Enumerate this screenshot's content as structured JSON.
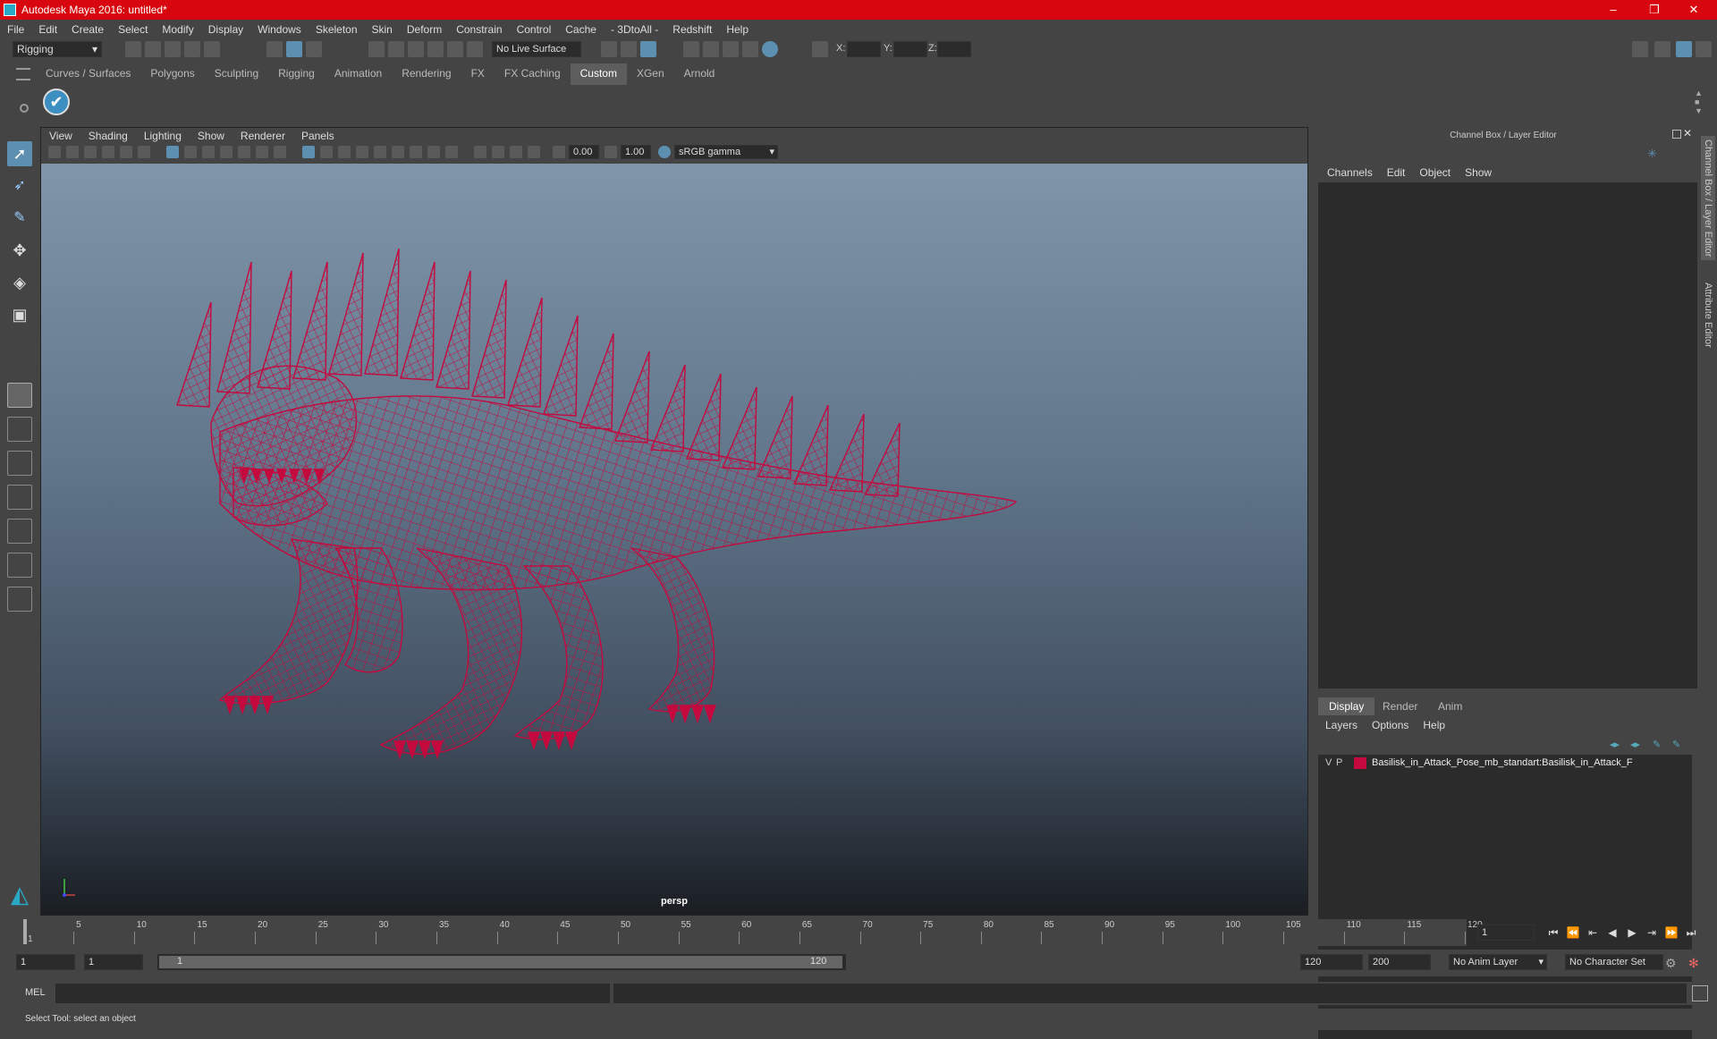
{
  "window": {
    "title": "Autodesk Maya 2016: untitled*",
    "controls": [
      "–",
      "❐",
      "✕"
    ]
  },
  "menubar": [
    "File",
    "Edit",
    "Create",
    "Select",
    "Modify",
    "Display",
    "Windows",
    "Skeleton",
    "Skin",
    "Deform",
    "Constrain",
    "Control",
    "Cache",
    "- 3DtoAll -",
    "Redshift",
    "Help"
  ],
  "statusline": {
    "mode": "Rigging",
    "live_surface": "No Live Surface",
    "x_label": "X:",
    "y_label": "Y:",
    "z_label": "Z:"
  },
  "shelf": {
    "tabs": [
      "Curves / Surfaces",
      "Polygons",
      "Sculpting",
      "Rigging",
      "Animation",
      "Rendering",
      "FX",
      "FX Caching",
      "Custom",
      "XGen",
      "Arnold"
    ],
    "active": "Custom"
  },
  "viewport": {
    "menu": [
      "View",
      "Shading",
      "Lighting",
      "Show",
      "Renderer",
      "Panels"
    ],
    "exposure": "0.00",
    "gamma": "1.00",
    "color_space": "sRGB gamma",
    "camera": "persp",
    "wire_color": "#c4093e"
  },
  "right_panel": {
    "title": "Channel Box / Layer Editor",
    "menu": [
      "Channels",
      "Edit",
      "Object",
      "Show"
    ],
    "layer_tabs": [
      "Display",
      "Render",
      "Anim"
    ],
    "active_layer_tab": "Display",
    "layer_menu": [
      "Layers",
      "Options",
      "Help"
    ],
    "layer": {
      "v": "V",
      "p": "P",
      "name": "Basilisk_in_Attack_Pose_mb_standart:Basilisk_in_Attack_F",
      "color": "#c4093e"
    },
    "side_tabs": [
      "Channel Box / Layer Editor",
      "Attribute Editor"
    ]
  },
  "timeline": {
    "ticks": [
      1,
      5,
      10,
      15,
      20,
      25,
      30,
      35,
      40,
      45,
      50,
      55,
      60,
      65,
      70,
      75,
      80,
      85,
      90,
      95,
      100,
      105,
      110,
      115,
      120
    ],
    "current_frame": "1",
    "frame_field": "1"
  },
  "range": {
    "start": "1",
    "inner_start": "1",
    "slider_start": "1",
    "slider_end": "120",
    "end": "120",
    "outer_end": "200",
    "anim_layer": "No Anim Layer",
    "char_set": "No Character Set"
  },
  "cmdline": {
    "label": "MEL"
  },
  "helpline": {
    "text": "Select Tool: select an object"
  }
}
